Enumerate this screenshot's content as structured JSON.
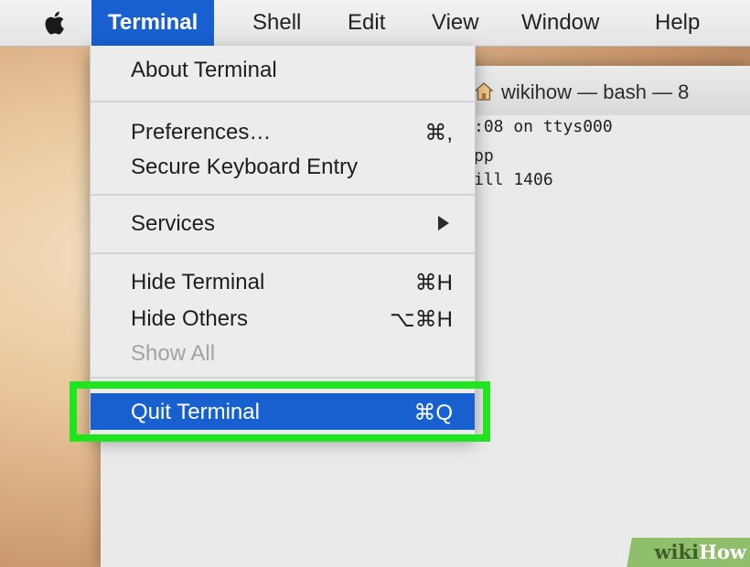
{
  "menubar": {
    "items": [
      {
        "label": "Terminal",
        "active": true
      },
      {
        "label": "Shell"
      },
      {
        "label": "Edit"
      },
      {
        "label": "View"
      },
      {
        "label": "Window"
      },
      {
        "label": "Help"
      }
    ],
    "apple_icon": "apple-logo-icon"
  },
  "dropdown": {
    "about": {
      "label": "About Terminal"
    },
    "preferences": {
      "label": "Preferences…",
      "shortcut": "⌘,"
    },
    "secure_entry": {
      "label": "Secure Keyboard Entry"
    },
    "services": {
      "label": "Services",
      "icon": "submenu-arrow-icon"
    },
    "hide_terminal": {
      "label": "Hide Terminal",
      "shortcut": "⌘H"
    },
    "hide_others": {
      "label": "Hide Others",
      "shortcut": "⌥⌘H"
    },
    "show_all": {
      "label": "Show All",
      "disabled": true
    },
    "quit": {
      "label": "Quit Terminal",
      "shortcut": "⌘Q",
      "selected": true
    }
  },
  "terminal": {
    "title": "wikihow — bash — 8",
    "title_icon": "home-icon",
    "lines": [
      ":08 on ttys000",
      "pp",
      "ill 1406"
    ]
  },
  "watermark": {
    "part1": "wiki",
    "part2": "How"
  },
  "colors": {
    "menu_highlight": "#1860d0",
    "callout_box": "#1fe51f",
    "menu_bg": "#ececec"
  }
}
